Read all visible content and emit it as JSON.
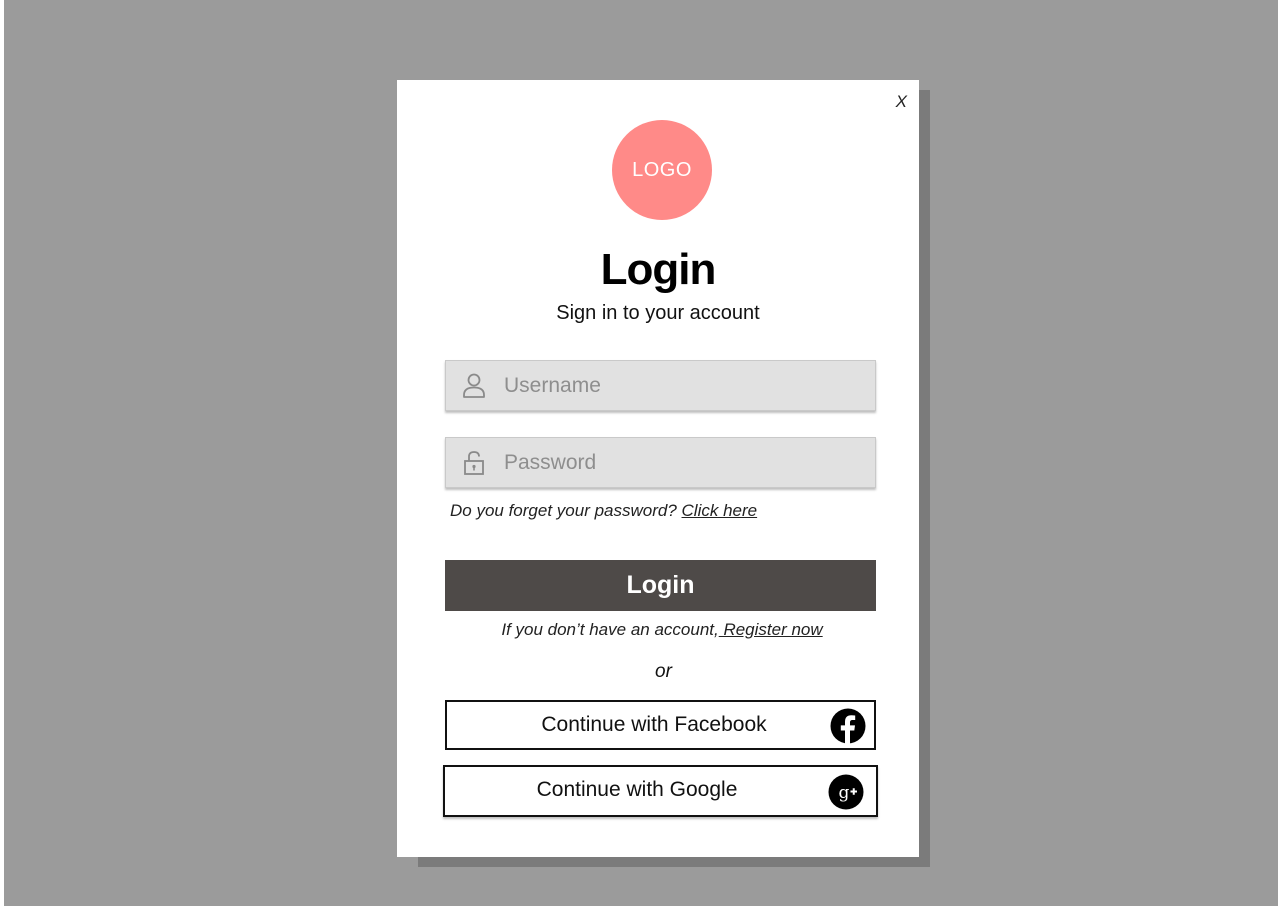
{
  "modal": {
    "close_label": "X",
    "logo_text": "LOGO",
    "title": "Login",
    "subtitle": "Sign in to your account"
  },
  "form": {
    "username_placeholder": "Username",
    "password_placeholder": "Password",
    "forgot_text": "Do you forget your password? ",
    "forgot_link": "Click here",
    "login_button": "Login",
    "register_text": "If you don’t have an account,",
    "register_link": " Register now",
    "or_text": "or"
  },
  "social": {
    "facebook_label": "Continue with Facebook",
    "google_label": "Continue with Google",
    "facebook_icon": "facebook-icon",
    "google_icon": "google-plus-icon"
  },
  "colors": {
    "backdrop": "#9b9b9b",
    "logo": "#ff8a88",
    "login_button": "#4e4a48",
    "field_bg": "#e1e1e1"
  }
}
